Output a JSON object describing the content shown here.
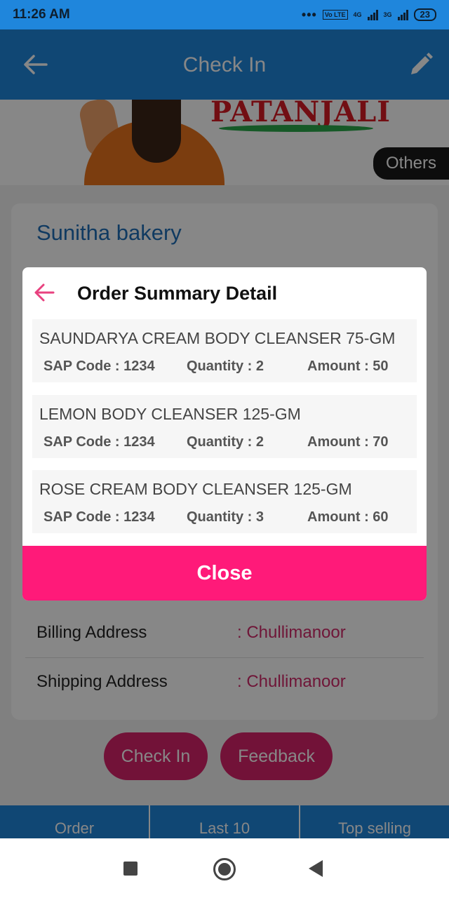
{
  "status_bar": {
    "time": "11:26 AM",
    "dots": "•••",
    "volte": "Vo LTE",
    "net1": "4G",
    "net2": "3G",
    "battery": "23"
  },
  "app_bar": {
    "title": "Check In",
    "back_icon": "arrow-back-icon",
    "edit_icon": "pencil-icon"
  },
  "banner": {
    "brand": "PATANJALI",
    "others_label": "Others"
  },
  "store": {
    "name": "Sunitha bakery",
    "billing_label": "Billing Address",
    "billing_value": ": Chullimanoor",
    "shipping_label": "Shipping Address",
    "shipping_value": ": Chullimanoor"
  },
  "actions": {
    "check_in": "Check In",
    "feedback": "Feedback"
  },
  "bottom_tabs": [
    "Order",
    "Last 10",
    "Top selling"
  ],
  "dialog": {
    "title": "Order Summary Detail",
    "items": [
      {
        "name": "SAUNDARYA CREAM BODY CLEANSER 75-GM",
        "sap": "SAP Code : 1234",
        "qty": "Quantity : 2",
        "amount": "Amount : 50"
      },
      {
        "name": "LEMON BODY CLEANSER 125-GM",
        "sap": "SAP Code : 1234",
        "qty": "Quantity : 2",
        "amount": "Amount : 70"
      },
      {
        "name": "ROSE CREAM BODY CLEANSER 125-GM",
        "sap": "SAP Code : 1234",
        "qty": "Quantity : 3",
        "amount": "Amount : 60"
      }
    ],
    "close_label": "Close"
  },
  "colors": {
    "primary": "#1f86dc",
    "accent": "#ff1a79",
    "link": "#1f6fb8"
  }
}
